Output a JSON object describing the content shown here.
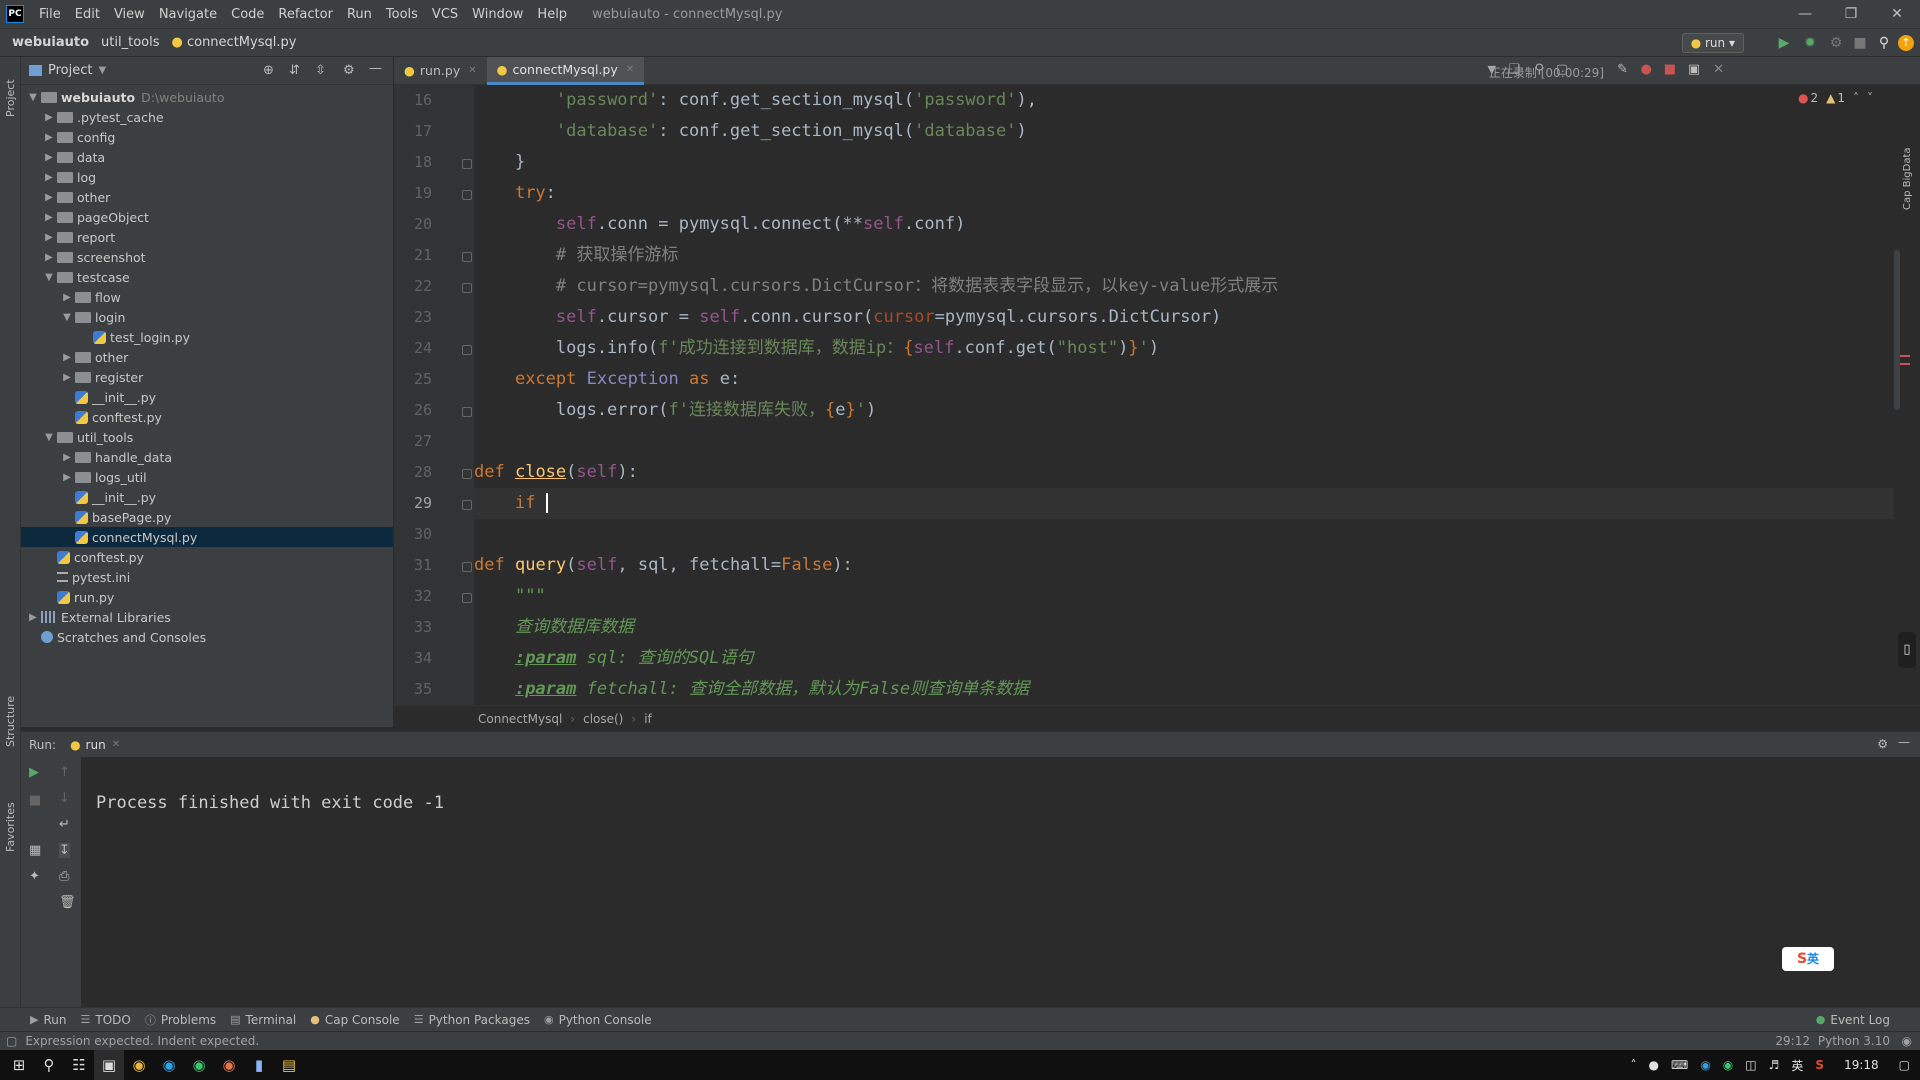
{
  "menubar": {
    "logo": "PC",
    "items": [
      "File",
      "Edit",
      "View",
      "Navigate",
      "Code",
      "Refactor",
      "Run",
      "Tools",
      "VCS",
      "Window",
      "Help"
    ],
    "window_title": "webuiauto - connectMysql.py"
  },
  "navbar": {
    "crumbs": [
      "webuiauto",
      "util_tools",
      "connectMysql.py"
    ],
    "run_config": "run"
  },
  "project": {
    "title": "Project",
    "root": "webuiauto",
    "root_path": "D:\\webuiauto",
    "items": [
      {
        "label": ".pytest_cache"
      },
      {
        "label": "config"
      },
      {
        "label": "data"
      },
      {
        "label": "log"
      },
      {
        "label": "other"
      },
      {
        "label": "pageObject"
      },
      {
        "label": "report"
      },
      {
        "label": "screenshot"
      },
      {
        "label": "testcase"
      },
      {
        "label": "flow"
      },
      {
        "label": "login"
      },
      {
        "label": "test_login.py"
      },
      {
        "label": "other"
      },
      {
        "label": "register"
      },
      {
        "label": "__init__.py"
      },
      {
        "label": "conftest.py"
      },
      {
        "label": "util_tools"
      },
      {
        "label": "handle_data"
      },
      {
        "label": "logs_util"
      },
      {
        "label": "__init__.py"
      },
      {
        "label": "basePage.py"
      },
      {
        "label": "connectMysql.py"
      },
      {
        "label": "conftest.py"
      },
      {
        "label": "pytest.ini"
      },
      {
        "label": "run.py"
      },
      {
        "label": "External Libraries"
      },
      {
        "label": "Scratches and Consoles"
      }
    ]
  },
  "tabs": [
    {
      "label": "run.py"
    },
    {
      "label": "connectMysql.py"
    }
  ],
  "recording": "正在录制 [00:00:29]",
  "inspections": {
    "errors": "2",
    "warnings": "1"
  },
  "editor": {
    "line_numbers": [
      "16",
      "17",
      "18",
      "19",
      "20",
      "21",
      "22",
      "23",
      "24",
      "25",
      "26",
      "27",
      "28",
      "29",
      "30",
      "31",
      "32",
      "33",
      "34",
      "35"
    ],
    "current_line": "29"
  },
  "breadcrumbs": [
    "ConnectMysql",
    "close()",
    "if"
  ],
  "run_panel": {
    "label": "Run:",
    "tab": "run",
    "output": "Process finished with exit code -1"
  },
  "tool_tabs": [
    "Run",
    "TODO",
    "Problems",
    "Terminal",
    "Cap Console",
    "Python Packages",
    "Python Console"
  ],
  "event_log": "Event Log",
  "status": {
    "message": "Expression expected. Indent expected.",
    "position": "29:12",
    "interpreter": "Python 3.10"
  },
  "side_labels": {
    "project": "Project",
    "structure": "Structure",
    "favorites": "Favorites",
    "right": "Cap BigData"
  },
  "taskbar": {
    "ime": "英",
    "time": "19:18"
  },
  "ime_badge": "英"
}
